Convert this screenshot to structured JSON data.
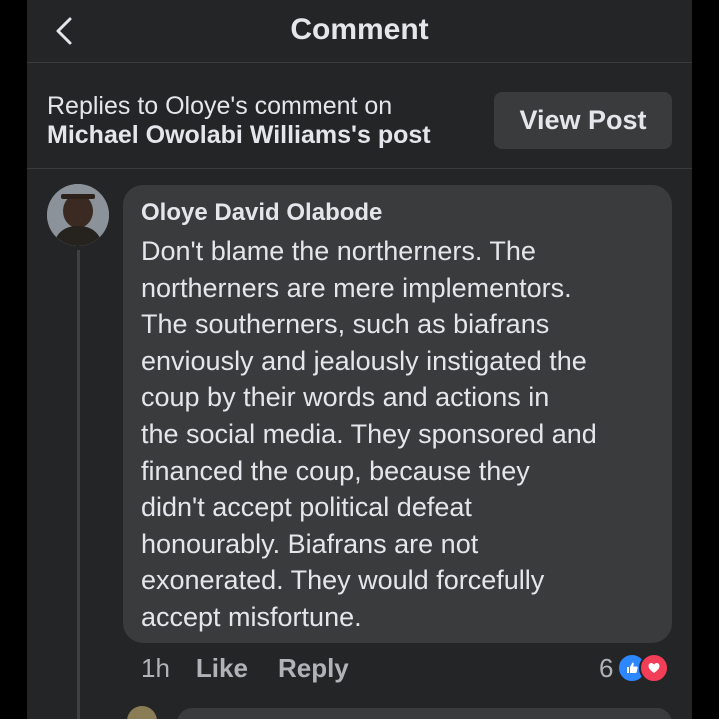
{
  "header": {
    "title": "Comment",
    "back_icon": "chevron-left-icon"
  },
  "context": {
    "prefix": "Replies to Oloye's comment on",
    "post_owner": "Michael Owolabi Williams's",
    "suffix": "post",
    "view_post_label": "View Post"
  },
  "comment": {
    "author": "Oloye David Olabode",
    "lines": [
      "Don't blame the northerners. The",
      "northerners are mere implementors.",
      "The southerners, such as biafrans",
      "enviously and jealously instigated the",
      "coup by their words and actions in",
      "the social media. They sponsored and",
      "financed the coup, because they",
      "didn't accept political defeat",
      "honourably. Biafrans are not",
      "exonerated. They would forcefully",
      "accept misfortune."
    ],
    "time": "1h",
    "like_label": "Like",
    "reply_label": "Reply",
    "reaction_count": "6",
    "reaction_icons": [
      "like-reaction-icon",
      "love-reaction-icon"
    ]
  },
  "colors": {
    "background": "#242526",
    "bubble": "#3a3b3c",
    "text": "#e4e6eb",
    "secondary_text": "#b0b3b8",
    "like_blue": "#2d88ff",
    "love_red": "#f33e58"
  }
}
